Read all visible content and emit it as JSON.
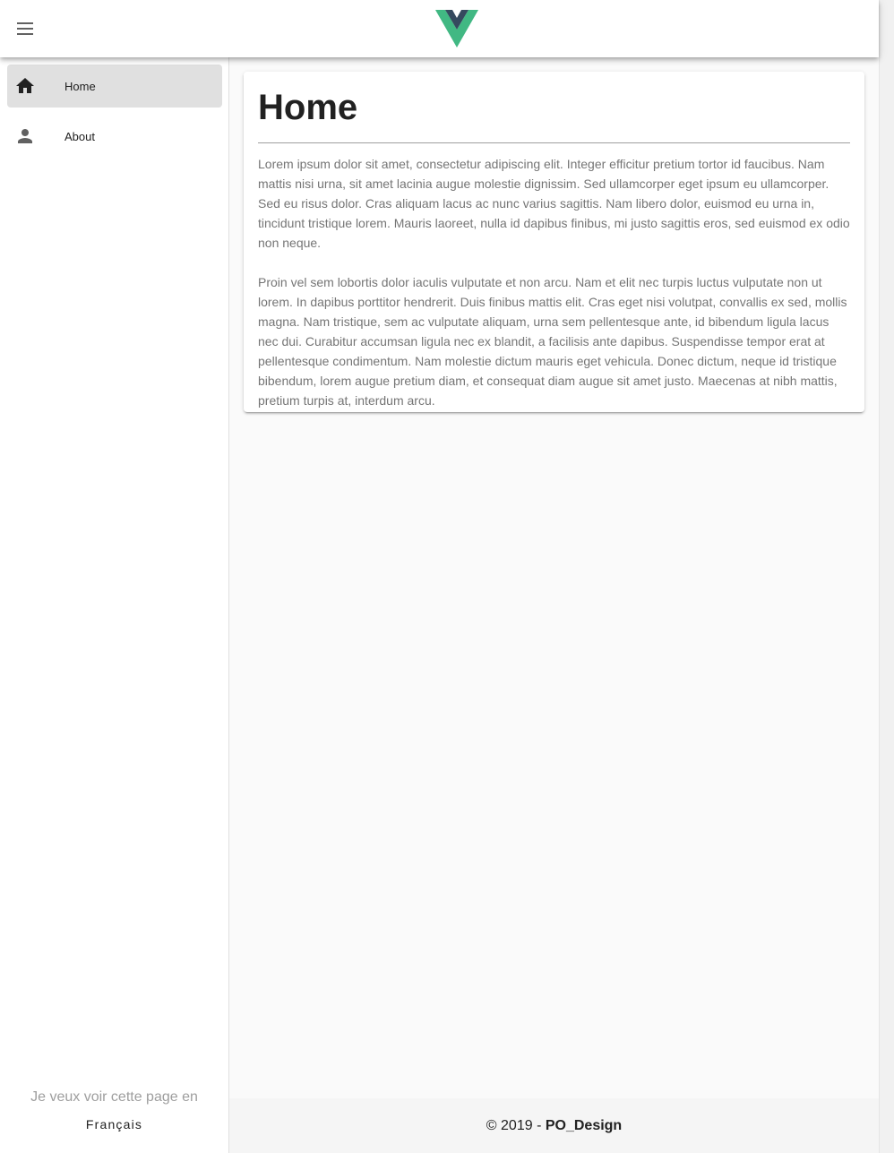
{
  "appbar": {
    "menu_icon": "menu-icon",
    "logo_icon": "vue-logo",
    "logo_colors": {
      "outer": "#41b883",
      "inner": "#35495e"
    }
  },
  "sidebar": {
    "items": [
      {
        "label": "Home",
        "icon": "home-icon",
        "active": true
      },
      {
        "label": "About",
        "icon": "person-icon",
        "active": false
      }
    ],
    "language": {
      "prompt": "Je veux voir cette page en",
      "link": "Français"
    }
  },
  "main": {
    "title": "Home",
    "paragraphs": [
      "Lorem ipsum dolor sit amet, consectetur adipiscing elit. Integer efficitur pretium tortor id faucibus. Nam mattis nisi urna, sit amet lacinia augue molestie dignissim. Sed ullamcorper eget ipsum eu ullamcorper. Sed eu risus dolor. Cras aliquam lacus ac nunc varius sagittis. Nam libero dolor, euismod eu urna in, tincidunt tristique lorem. Mauris laoreet, nulla id dapibus finibus, mi justo sagittis eros, sed euismod ex odio non neque.",
      "Proin vel sem lobortis dolor iaculis vulputate et non arcu. Nam et elit nec turpis luctus vulputate non ut lorem. In dapibus porttitor hendrerit. Duis finibus mattis elit. Cras eget nisi volutpat, convallis ex sed, mollis magna. Nam tristique, sem ac vulputate aliquam, urna sem pellentesque ante, id bibendum ligula lacus nec dui. Curabitur accumsan ligula nec ex blandit, a facilisis ante dapibus. Suspendisse tempor erat at pellentesque condimentum. Nam molestie dictum mauris eget vehicula. Donec dictum, neque id tristique bibendum, lorem augue pretium diam, et consequat diam augue sit amet justo. Maecenas at nibh mattis, pretium turpis at, interdum arcu."
    ]
  },
  "footer": {
    "copyright": "© 2019 - ",
    "brand": "PO_Design"
  }
}
